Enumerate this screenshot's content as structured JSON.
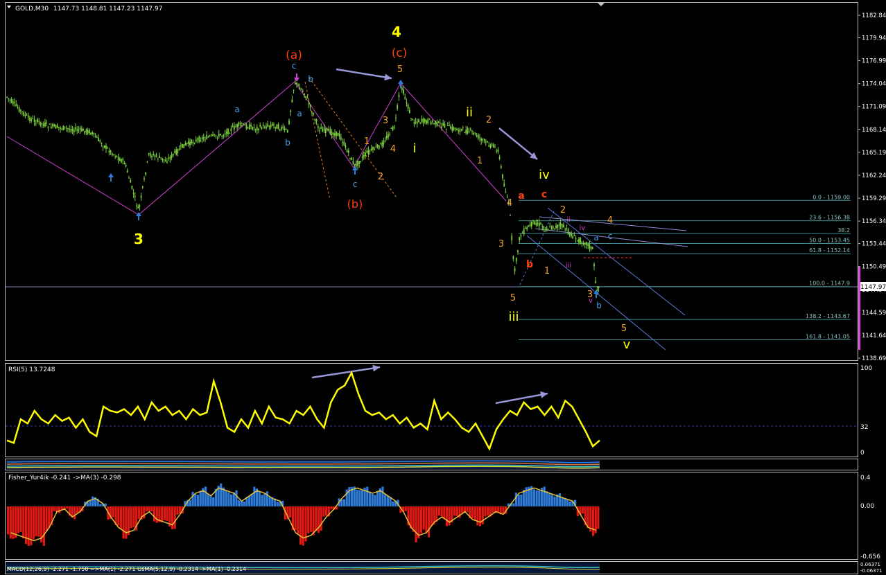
{
  "header": {
    "symbol_label": "GOLD,M30",
    "ohlc": "1147.73 1148.81 1147.23 1147.97"
  },
  "price_axis": {
    "ticks": [
      "1182.84",
      "1179.94",
      "1176.99",
      "1174.04",
      "1171.09",
      "1168.14",
      "1165.19",
      "1162.24",
      "1159.29",
      "1156.34",
      "1153.44",
      "1150.49",
      "1147.54",
      "1144.59",
      "1141.64",
      "1138.69"
    ],
    "current_price": "1147.97"
  },
  "fib_levels": [
    {
      "label": "0.0 - 1159.00",
      "price": 1159.0
    },
    {
      "label": "23.6 - 1156.38",
      "price": 1156.38
    },
    {
      "label": "38.2",
      "price": 1154.75
    },
    {
      "label": "50.0 - 1153.45",
      "price": 1153.45
    },
    {
      "label": "61.8 - 1152.14",
      "price": 1152.14
    },
    {
      "label": "100.0 - 1147.9",
      "price": 1147.9
    },
    {
      "label": "138.2 - 1143.67",
      "price": 1143.67
    },
    {
      "label": "161.8 - 1141.05",
      "price": 1141.05
    }
  ],
  "wave_labels": {
    "big_3": "3",
    "big_4": "4",
    "a_paren": "(a)",
    "c_paren": "(c)",
    "b_paren": "(b)",
    "ii": "ii",
    "i": "i",
    "iv": "iv",
    "iii": "iii",
    "v_big": "v",
    "a_red": "a",
    "c_red": "c",
    "b_red": "b",
    "small_a": "a",
    "small_b": "b",
    "small_c": "c",
    "small_1": "1",
    "small_2": "2",
    "small_3": "3",
    "small_4": "4",
    "small_5": "5",
    "purple_ii": "ii",
    "purple_iii": "iii",
    "purple_iv": "iv",
    "purple_v": "v"
  },
  "rsi": {
    "label": "RSI(5) 13.7248",
    "ticks": [
      "100",
      "32",
      "0"
    ]
  },
  "fisher": {
    "label": "Fisher_Yur4ik -0.241  ->MA(3) -0.298",
    "ticks": [
      "0.4",
      "0.00",
      "-0.656"
    ]
  },
  "macd": {
    "label": "MACD(12,26,9) -2.271 -1.750  =>MA(1) -2.271  OsMA(5,12,9) -0.2314  ->MA(1) -0.2314",
    "ticks": [
      "0.06371",
      "-0.06371"
    ]
  },
  "colors": {
    "background": "#000000",
    "panel_border": "#c0c0c0",
    "candle": "#7ccf3c",
    "rsi_line": "#ffff00",
    "fisher_pos": "#2f7bd8",
    "fisher_neg": "#e01a12",
    "fisher_line": "#e8c33a",
    "arrow_lavender": "#9898d8",
    "wave_yellow": "#ffff00",
    "wave_red": "#ff4010",
    "wave_orange": "#f0a030",
    "wave_blue": "#4aa0e8",
    "wave_purple": "#d040d0",
    "fib_line": "#3b8e8e"
  }
}
